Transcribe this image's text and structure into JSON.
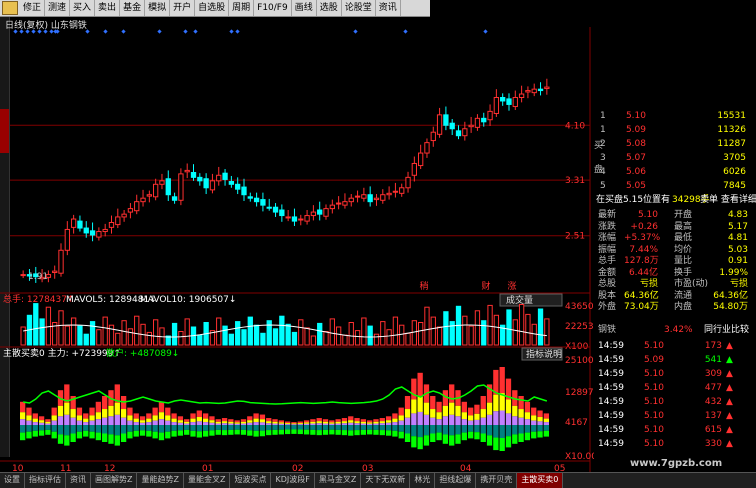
{
  "toolbar": {
    "items": [
      "修正",
      "测速",
      "买入",
      "卖出",
      "基金",
      "模拟",
      "开户",
      "自选股",
      "周期",
      "F10/F9",
      "画线",
      "选股",
      "论股堂",
      "资讯"
    ]
  },
  "header": {
    "title": "日线(复权) 山东钢铁"
  },
  "price_axis": {
    "labels": [
      "4.10",
      "3.31",
      "2.51"
    ],
    "low_label": "1.91"
  },
  "markers": {
    "left": "稍",
    "mid": "财",
    "right": "涨"
  },
  "volume": {
    "total": "总手: 1278437↑",
    "mavol5": "MAVOL5: 1289481↓",
    "mavol10": "MAVOL10: 1906507↓",
    "button": "成交量",
    "axis": [
      "43650",
      "22253",
      "X100"
    ]
  },
  "indicator": {
    "title": "主散买卖0 主力: +723999↑",
    "retail": "散户: +487089↓",
    "button": "指标说明",
    "axis": [
      "251005",
      "128973",
      "4167",
      "X10.00"
    ]
  },
  "date_axis": [
    "10",
    "11",
    "12",
    "01",
    "02",
    "03",
    "04",
    "05"
  ],
  "order_book": {
    "rows": [
      [
        "1",
        "5.10",
        "15531"
      ],
      [
        "1",
        "5.09",
        "11326"
      ],
      [
        "2",
        "5.08",
        "11287"
      ],
      [
        "3",
        "5.07",
        "3705"
      ],
      [
        "4",
        "5.06",
        "6026"
      ],
      [
        "5",
        "5.05",
        "7845"
      ]
    ],
    "side_labels": [
      "买",
      "盘"
    ],
    "status_bar": {
      "left": "在买盘5.15位置有",
      "amount": "34298手",
      "right": "卖单 查看详细"
    }
  },
  "stats": [
    [
      "最新",
      "5.10",
      "开盘",
      "4.83"
    ],
    [
      "涨跌",
      "+0.26",
      "最高",
      "5.17"
    ],
    [
      "涨幅",
      "+5.37%",
      "最低",
      "4.81"
    ],
    [
      "振幅",
      "7.44%",
      "均价",
      "5.03"
    ],
    [
      "总手",
      "127.8万",
      "量比",
      "0.91"
    ],
    [
      "金额",
      "6.44亿",
      "换手",
      "1.99%"
    ],
    [
      "总股",
      "亏损",
      "市盈(动)",
      "亏损"
    ],
    [
      "股本",
      "64.36亿",
      "流通",
      "64.36亿"
    ],
    [
      "外盘",
      "73.04万",
      "内盘",
      "54.80万"
    ]
  ],
  "industry": {
    "name": "钢铁",
    "change": "3.42%",
    "link": "同行业比较"
  },
  "ticks": [
    [
      "14:59",
      "5.10",
      "173"
    ],
    [
      "14:59",
      "5.09",
      "541"
    ],
    [
      "14:59",
      "5.10",
      "309"
    ],
    [
      "14:59",
      "5.10",
      "477"
    ],
    [
      "14:59",
      "5.10",
      "432"
    ],
    [
      "14:59",
      "5.10",
      "137"
    ],
    [
      "14:59",
      "5.10",
      "615"
    ],
    [
      "14:59",
      "5.10",
      "330"
    ]
  ],
  "bottom_tabs": [
    "设置",
    "指标评估",
    "资讯",
    "画图解势Z",
    "量能趋势Z",
    "量能金叉Z",
    "短波买点",
    "KDJ波段F",
    "黑马金叉Z",
    "天下无双新",
    "林光",
    "担线起爆",
    "携开贝壳",
    "主散买卖0"
  ],
  "watermark": "www.7gpzb.com",
  "colors": {
    "up": "#ff3030",
    "down": "#00ffff",
    "grid": "#800000",
    "yellow": "#ffff00",
    "green": "#00ff00",
    "purple": "#c080ff"
  },
  "chart_data": [
    {
      "type": "candlestick",
      "title": "日线(复权) 山东钢铁",
      "ylim": [
        1.8,
        5.4
      ],
      "close": [
        1.95,
        1.93,
        1.92,
        1.91,
        1.95,
        2.0,
        2.3,
        2.6,
        2.75,
        2.62,
        2.55,
        2.52,
        2.57,
        2.6,
        2.7,
        2.78,
        2.82,
        2.9,
        3.0,
        3.05,
        3.1,
        3.25,
        3.3,
        3.1,
        3.02,
        3.4,
        3.45,
        3.35,
        3.3,
        3.2,
        3.3,
        3.38,
        3.32,
        3.25,
        3.18,
        3.1,
        3.05,
        3.0,
        2.95,
        2.92,
        2.85,
        2.8,
        2.78,
        2.72,
        2.75,
        2.8,
        2.85,
        2.82,
        2.9,
        2.95,
        2.98,
        3.0,
        3.05,
        3.08,
        3.1,
        3.0,
        3.05,
        3.1,
        3.12,
        3.15,
        3.2,
        3.35,
        3.55,
        3.7,
        3.85,
        4.0,
        4.25,
        4.1,
        4.05,
        3.95,
        4.05,
        4.1,
        4.2,
        4.15,
        4.3,
        4.5,
        4.45,
        4.4,
        4.5,
        4.55,
        4.6,
        4.62,
        4.6,
        4.65
      ]
    },
    {
      "type": "bar",
      "title": "成交量",
      "ylim": [
        0,
        43650
      ]
    },
    {
      "type": "area",
      "title": "主散买卖0",
      "ylim": [
        -120000,
        251005
      ]
    }
  ]
}
